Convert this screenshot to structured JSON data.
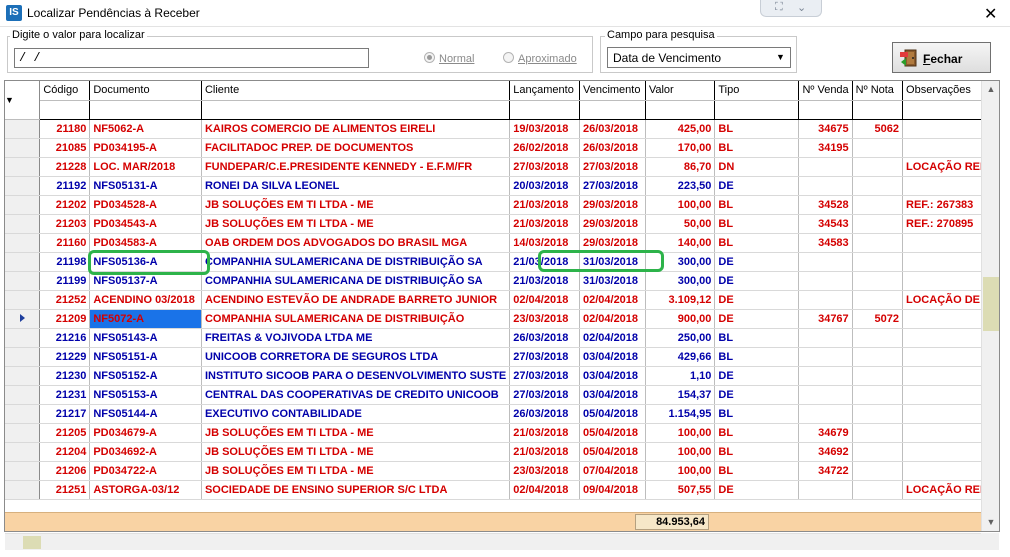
{
  "window": {
    "title": "Localizar Pendências à Receber",
    "app_icon_text": "IS",
    "close_glyph": "✕"
  },
  "search": {
    "label": "Digite o valor para localizar",
    "value": " / /"
  },
  "mode": {
    "normal_label": "Normal",
    "approx_label": "Aproximado",
    "selected": "Normal"
  },
  "field": {
    "label": "Campo para pesquisa",
    "selected": "Data de Vencimento"
  },
  "close_button": {
    "label": "Fechar"
  },
  "grid": {
    "columns": [
      "Código",
      "Documento",
      "Cliente",
      "Lançamento",
      "Vencimento",
      "Valor",
      "Tipo",
      "Nº Venda",
      "Nº Nota",
      "Observações"
    ],
    "rows": [
      {
        "color": "red",
        "codigo": "21180",
        "documento": "NF5062-A",
        "cliente": "KAIROS COMERCIO DE ALIMENTOS EIRELI",
        "lancamento": "19/03/2018",
        "vencimento": "26/03/2018",
        "valor": "425,00",
        "tipo": "BL",
        "venda": "34675",
        "nota": "5062",
        "obs": ""
      },
      {
        "color": "red",
        "codigo": "21085",
        "documento": "PD034195-A",
        "cliente": "FACILITADOC PREP. DE DOCUMENTOS",
        "lancamento": "26/02/2018",
        "vencimento": "26/03/2018",
        "valor": "170,00",
        "tipo": "BL",
        "venda": "34195",
        "nota": "",
        "obs": ""
      },
      {
        "color": "red",
        "codigo": "21228",
        "documento": "LOC. MAR/2018",
        "cliente": "FUNDEPAR/C.E.PRESIDENTE KENNEDY - E.F.M/FR",
        "lancamento": "27/03/2018",
        "vencimento": "27/03/2018",
        "valor": "86,70",
        "tipo": "DN",
        "venda": "",
        "nota": "",
        "obs": "LOCAÇÃO REF."
      },
      {
        "color": "blue",
        "codigo": "21192",
        "documento": "NFS05131-A",
        "cliente": "RONEI DA SILVA LEONEL",
        "lancamento": "20/03/2018",
        "vencimento": "27/03/2018",
        "valor": "223,50",
        "tipo": "DE",
        "venda": "",
        "nota": "",
        "obs": ""
      },
      {
        "color": "red",
        "codigo": "21202",
        "documento": "PD034528-A",
        "cliente": "JB SOLUÇÕES EM TI LTDA - ME",
        "lancamento": "21/03/2018",
        "vencimento": "29/03/2018",
        "valor": "100,00",
        "tipo": "BL",
        "venda": "34528",
        "nota": "",
        "obs": "REF.: 267383"
      },
      {
        "color": "red",
        "codigo": "21203",
        "documento": "PD034543-A",
        "cliente": "JB SOLUÇÕES EM TI LTDA - ME",
        "lancamento": "21/03/2018",
        "vencimento": "29/03/2018",
        "valor": "50,00",
        "tipo": "BL",
        "venda": "34543",
        "nota": "",
        "obs": "REF.: 270895"
      },
      {
        "color": "red",
        "codigo": "21160",
        "documento": "PD034583-A",
        "cliente": "OAB ORDEM DOS ADVOGADOS DO BRASIL  MGA",
        "lancamento": "14/03/2018",
        "vencimento": "29/03/2018",
        "valor": "140,00",
        "tipo": "BL",
        "venda": "34583",
        "nota": "",
        "obs": ""
      },
      {
        "color": "blue",
        "codigo": "21198",
        "documento": "NFS05136-A",
        "cliente": "COMPANHIA SULAMERICANA DE DISTRIBUIÇÃO SA",
        "lancamento": "21/03/2018",
        "vencimento": "31/03/2018",
        "valor": "300,00",
        "tipo": "DE",
        "venda": "",
        "nota": "",
        "obs": ""
      },
      {
        "color": "blue",
        "codigo": "21199",
        "documento": "NFS05137-A",
        "cliente": "COMPANHIA SULAMERICANA DE DISTRIBUIÇÃO SA",
        "lancamento": "21/03/2018",
        "vencimento": "31/03/2018",
        "valor": "300,00",
        "tipo": "DE",
        "venda": "",
        "nota": "",
        "obs": ""
      },
      {
        "color": "red",
        "codigo": "21252",
        "documento": "ACENDINO 03/2018",
        "cliente": "ACENDINO ESTEVÃO DE ANDRADE BARRETO JUNIOR",
        "lancamento": "02/04/2018",
        "vencimento": "02/04/2018",
        "valor": "3.109,12",
        "tipo": "DE",
        "venda": "",
        "nota": "",
        "obs": "LOCAÇÃO DE M"
      },
      {
        "color": "red",
        "codigo": "21209",
        "documento": "NF5072-A",
        "cliente": "COMPANHIA SULAMERICANA DE DISTRIBUIÇÃO",
        "lancamento": "23/03/2018",
        "vencimento": "02/04/2018",
        "valor": "900,00",
        "tipo": "DE",
        "venda": "34767",
        "nota": "5072",
        "obs": "",
        "current": true
      },
      {
        "color": "blue",
        "codigo": "21216",
        "documento": "NFS05143-A",
        "cliente": "FREITAS & VOJIVODA LTDA ME",
        "lancamento": "26/03/2018",
        "vencimento": "02/04/2018",
        "valor": "250,00",
        "tipo": "BL",
        "venda": "",
        "nota": "",
        "obs": ""
      },
      {
        "color": "blue",
        "codigo": "21229",
        "documento": "NFS05151-A",
        "cliente": "UNICOOB CORRETORA DE SEGUROS LTDA",
        "lancamento": "27/03/2018",
        "vencimento": "03/04/2018",
        "valor": "429,66",
        "tipo": "BL",
        "venda": "",
        "nota": "",
        "obs": ""
      },
      {
        "color": "blue",
        "codigo": "21230",
        "documento": "NFS05152-A",
        "cliente": "INSTITUTO SICOOB PARA O DESENVOLVIMENTO SUSTE",
        "lancamento": "27/03/2018",
        "vencimento": "03/04/2018",
        "valor": "1,10",
        "tipo": "DE",
        "venda": "",
        "nota": "",
        "obs": ""
      },
      {
        "color": "blue",
        "codigo": "21231",
        "documento": "NFS05153-A",
        "cliente": "CENTRAL DAS COOPERATIVAS DE CREDITO UNICOOB",
        "lancamento": "27/03/2018",
        "vencimento": "03/04/2018",
        "valor": "154,37",
        "tipo": "DE",
        "venda": "",
        "nota": "",
        "obs": ""
      },
      {
        "color": "blue",
        "codigo": "21217",
        "documento": "NFS05144-A",
        "cliente": "EXECUTIVO CONTABILIDADE",
        "lancamento": "26/03/2018",
        "vencimento": "05/04/2018",
        "valor": "1.154,95",
        "tipo": "BL",
        "venda": "",
        "nota": "",
        "obs": ""
      },
      {
        "color": "red",
        "codigo": "21205",
        "documento": "PD034679-A",
        "cliente": "JB SOLUÇÕES EM TI LTDA - ME",
        "lancamento": "21/03/2018",
        "vencimento": "05/04/2018",
        "valor": "100,00",
        "tipo": "BL",
        "venda": "34679",
        "nota": "",
        "obs": ""
      },
      {
        "color": "red",
        "codigo": "21204",
        "documento": "PD034692-A",
        "cliente": "JB SOLUÇÕES EM TI LTDA - ME",
        "lancamento": "21/03/2018",
        "vencimento": "05/04/2018",
        "valor": "100,00",
        "tipo": "BL",
        "venda": "34692",
        "nota": "",
        "obs": ""
      },
      {
        "color": "red",
        "codigo": "21206",
        "documento": "PD034722-A",
        "cliente": "JB SOLUÇÕES EM TI LTDA - ME",
        "lancamento": "23/03/2018",
        "vencimento": "07/04/2018",
        "valor": "100,00",
        "tipo": "BL",
        "venda": "34722",
        "nota": "",
        "obs": ""
      },
      {
        "color": "red",
        "codigo": "21251",
        "documento": "ASTORGA-03/12",
        "cliente": "SOCIEDADE DE ENSINO SUPERIOR S/C LTDA",
        "lancamento": "02/04/2018",
        "vencimento": "09/04/2018",
        "valor": "507,55",
        "tipo": "DE",
        "venda": "",
        "nota": "",
        "obs": "LOCAÇÃO REFE"
      }
    ]
  },
  "total": {
    "value": "84.953,64"
  },
  "colors": {
    "red_text": "#d40000",
    "blue_text": "#0000aa",
    "selected_cell": "#1a73e8",
    "total_bar": "#f9d3a4",
    "highlight_ring": "#2db34a"
  }
}
